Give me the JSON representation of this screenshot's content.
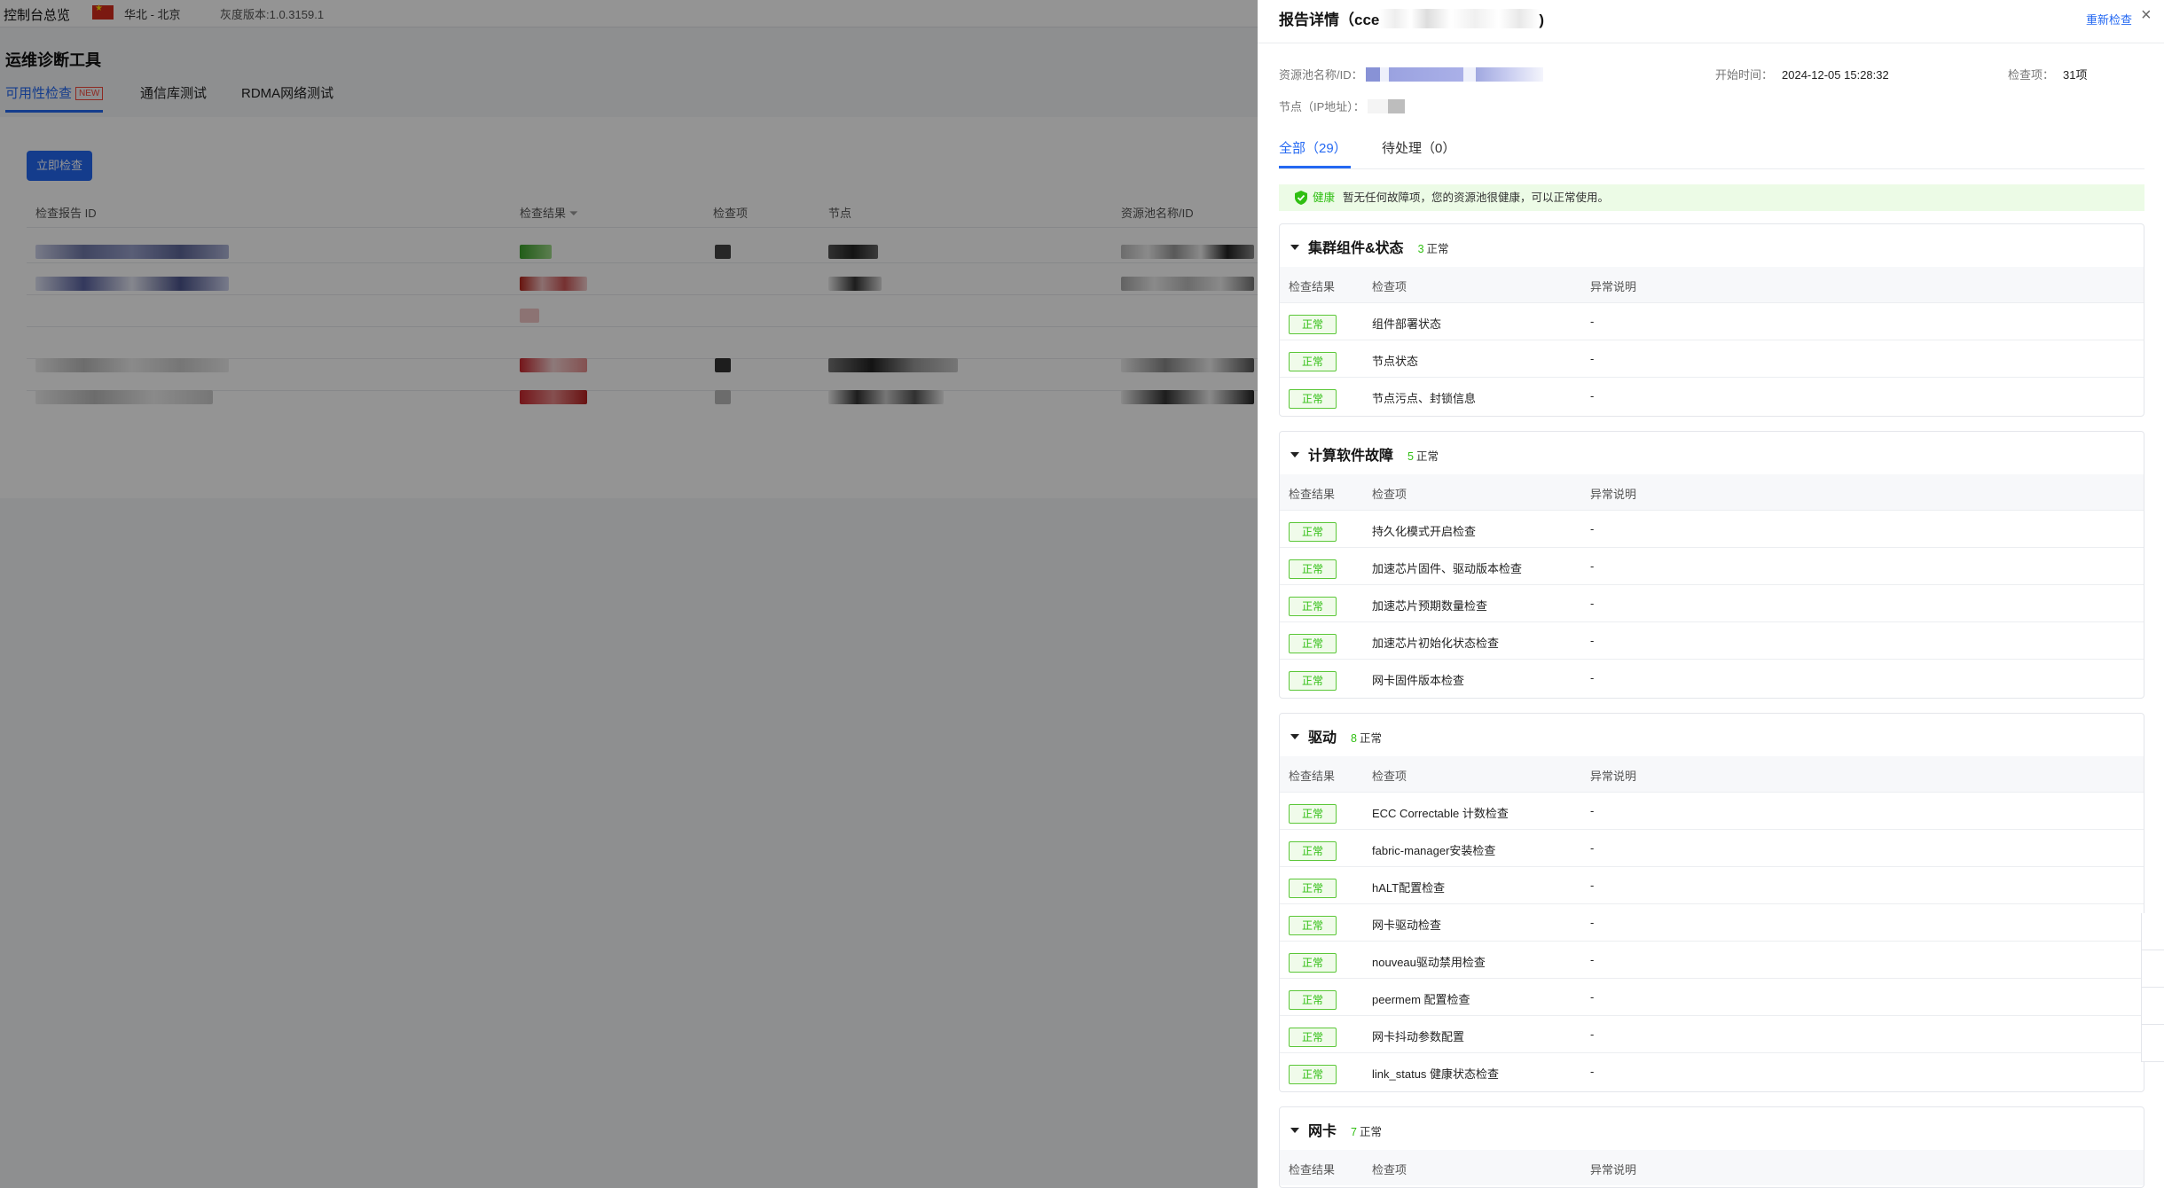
{
  "topbar": {
    "console_label": "控制台总览",
    "region": "华北 - 北京",
    "version": "灰度版本:1.0.3159.1"
  },
  "page": {
    "title": "运维诊断工具",
    "tabs": [
      {
        "label": "可用性检查",
        "badge": "NEW",
        "active": true
      },
      {
        "label": "通信库测试",
        "active": false
      },
      {
        "label": "RDMA网络测试",
        "active": false
      }
    ],
    "primary_button": "立即检查",
    "table_headers": [
      "检查报告 ID",
      "检查结果",
      "检查项",
      "节点",
      "资源池名称/ID"
    ]
  },
  "drawer": {
    "title_prefix": "报告详情（cce",
    "title_suffix": ")",
    "recheck_label": "重新检查",
    "close_icon": "×",
    "meta": {
      "pool_label": "资源池名称/ID：",
      "start_label": "开始时间：",
      "start_value": "2024-12-05 15:28:32",
      "items_label": "检查项：",
      "items_value": "31项",
      "node_label": "节点（IP地址）："
    },
    "tabs": [
      {
        "label": "全部（29）",
        "active": true
      },
      {
        "label": "待处理（0）",
        "active": false
      }
    ],
    "notice": {
      "highlight": "健康",
      "message": "暂无任何故障项，您的资源池很健康，可以正常使用。",
      "accent": "#30bf13"
    },
    "columns": [
      "检查结果",
      "检查项",
      "异常说明"
    ],
    "status_label": "正常",
    "sections": [
      {
        "title": "集群组件&状态",
        "count": "3",
        "count_label": "正常",
        "rows": [
          {
            "item": "组件部署状态",
            "note": "-"
          },
          {
            "item": "节点状态",
            "note": "-"
          },
          {
            "item": "节点污点、封锁信息",
            "note": "-"
          }
        ]
      },
      {
        "title": "计算软件故障",
        "count": "5",
        "count_label": "正常",
        "rows": [
          {
            "item": "持久化模式开启检查",
            "note": "-"
          },
          {
            "item": "加速芯片固件、驱动版本检查",
            "note": "-"
          },
          {
            "item": "加速芯片预期数量检查",
            "note": "-"
          },
          {
            "item": "加速芯片初始化状态检查",
            "note": "-"
          },
          {
            "item": "网卡固件版本检查",
            "note": "-"
          }
        ]
      },
      {
        "title": "驱动",
        "count": "8",
        "count_label": "正常",
        "rows": [
          {
            "item": "ECC Correctable 计数检查",
            "note": "-"
          },
          {
            "item": "fabric-manager安装检查",
            "note": "-"
          },
          {
            "item": "hALT配置检查",
            "note": "-"
          },
          {
            "item": "网卡驱动检查",
            "note": "-"
          },
          {
            "item": "nouveau驱动禁用检查",
            "note": "-"
          },
          {
            "item": "peermem 配置检查",
            "note": "-"
          },
          {
            "item": "网卡抖动参数配置",
            "note": "-"
          },
          {
            "item": "link_status 健康状态检查",
            "note": "-"
          }
        ]
      },
      {
        "title": "网卡",
        "count": "7",
        "count_label": "正常",
        "rows": []
      }
    ]
  },
  "colors": {
    "primary": "#2468f2",
    "success": "#30bf13",
    "success_bg": "#f0fbea"
  }
}
